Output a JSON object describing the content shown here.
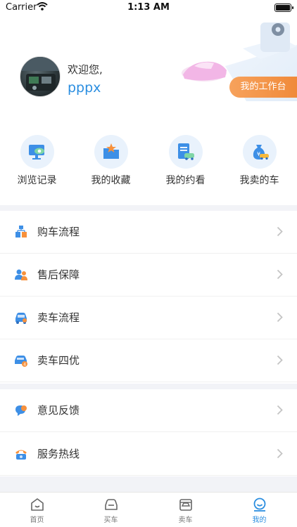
{
  "status_bar": {
    "carrier": "Carrier",
    "time": "1:13 AM"
  },
  "header": {
    "greeting": "欢迎您,",
    "username": "pppx",
    "workbench_button": "我的工作台"
  },
  "quick_actions": [
    {
      "label": "浏览记录",
      "icon": "browse-history-icon"
    },
    {
      "label": "我的收藏",
      "icon": "favorites-icon"
    },
    {
      "label": "我的约看",
      "icon": "appointments-icon"
    },
    {
      "label": "我卖的车",
      "icon": "my-sold-cars-icon"
    }
  ],
  "menu": [
    {
      "label": "购车流程",
      "icon": "purchase-flow-icon"
    },
    {
      "label": "售后保障",
      "icon": "after-sales-icon"
    },
    {
      "label": "卖车流程",
      "icon": "sell-flow-icon"
    },
    {
      "label": "卖车四优",
      "icon": "sell-advantages-icon"
    },
    {
      "label": "意见反馈",
      "icon": "feedback-icon"
    },
    {
      "label": "服务热线",
      "icon": "hotline-icon"
    }
  ],
  "tabbar": [
    {
      "label": "首页",
      "icon": "home-icon"
    },
    {
      "label": "买车",
      "icon": "buy-car-icon"
    },
    {
      "label": "卖车",
      "icon": "sell-car-icon"
    },
    {
      "label": "我的",
      "icon": "profile-icon",
      "active": true
    }
  ],
  "colors": {
    "accent": "#2b8ee0",
    "orange": "#f08a3a",
    "divider": "#f2f3f7"
  }
}
